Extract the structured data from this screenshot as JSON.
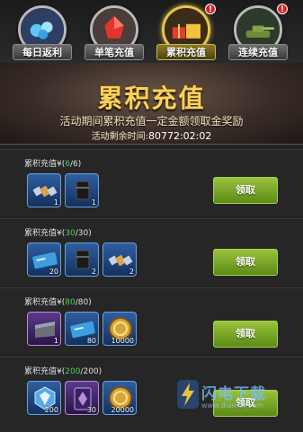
{
  "tabs": [
    {
      "label": "每日返利",
      "badge": ""
    },
    {
      "label": "单笔充值",
      "badge": ""
    },
    {
      "label": "累积充值",
      "badge": "!"
    },
    {
      "label": "连续充值",
      "badge": "!"
    }
  ],
  "banner": {
    "title": "累积充值",
    "subtitle": "活动期间累积充值一定金额领取金奖励",
    "timer_label": "活动剩余时间:",
    "timer_value": "80772:02:02"
  },
  "rows": [
    {
      "prefix": "累积充值¥(",
      "current": "6",
      "separator": "/",
      "target": "6",
      "suffix": ")",
      "claim_label": "领取",
      "items": [
        {
          "icon": "satellite-icon",
          "qty": "1"
        },
        {
          "icon": "oil-barrel-icon",
          "qty": "1"
        }
      ]
    },
    {
      "prefix": "累积充值¥(",
      "current": "30",
      "separator": "/",
      "target": "30",
      "suffix": ")",
      "claim_label": "领取",
      "items": [
        {
          "icon": "ticket-icon",
          "qty": "20"
        },
        {
          "icon": "oil-barrel-icon",
          "qty": "2"
        },
        {
          "icon": "satellite-icon",
          "qty": "2"
        }
      ]
    },
    {
      "prefix": "累积充值¥(",
      "current": "80",
      "separator": "/",
      "target": "80",
      "suffix": ")",
      "claim_label": "领取",
      "items": [
        {
          "icon": "crate-icon",
          "qty": "1"
        },
        {
          "icon": "ticket-icon",
          "qty": "80"
        },
        {
          "icon": "gold-coin-icon",
          "qty": "10000"
        }
      ]
    },
    {
      "prefix": "累积充值¥(",
      "current": "200",
      "separator": "/",
      "target": "200",
      "suffix": ")",
      "claim_label": "领取",
      "items": [
        {
          "icon": "shield-crystal-icon",
          "qty": "200"
        },
        {
          "icon": "purple-card-icon",
          "qty": "30"
        },
        {
          "icon": "gold-coin-icon",
          "qty": "20000"
        }
      ]
    }
  ],
  "watermark": {
    "text": "闪电下载",
    "url": "www.dianxw.com"
  },
  "colors": {
    "accent_gold": "#f6d35a",
    "progress_green": "#52d052",
    "claim_green": "#7fb02a"
  }
}
